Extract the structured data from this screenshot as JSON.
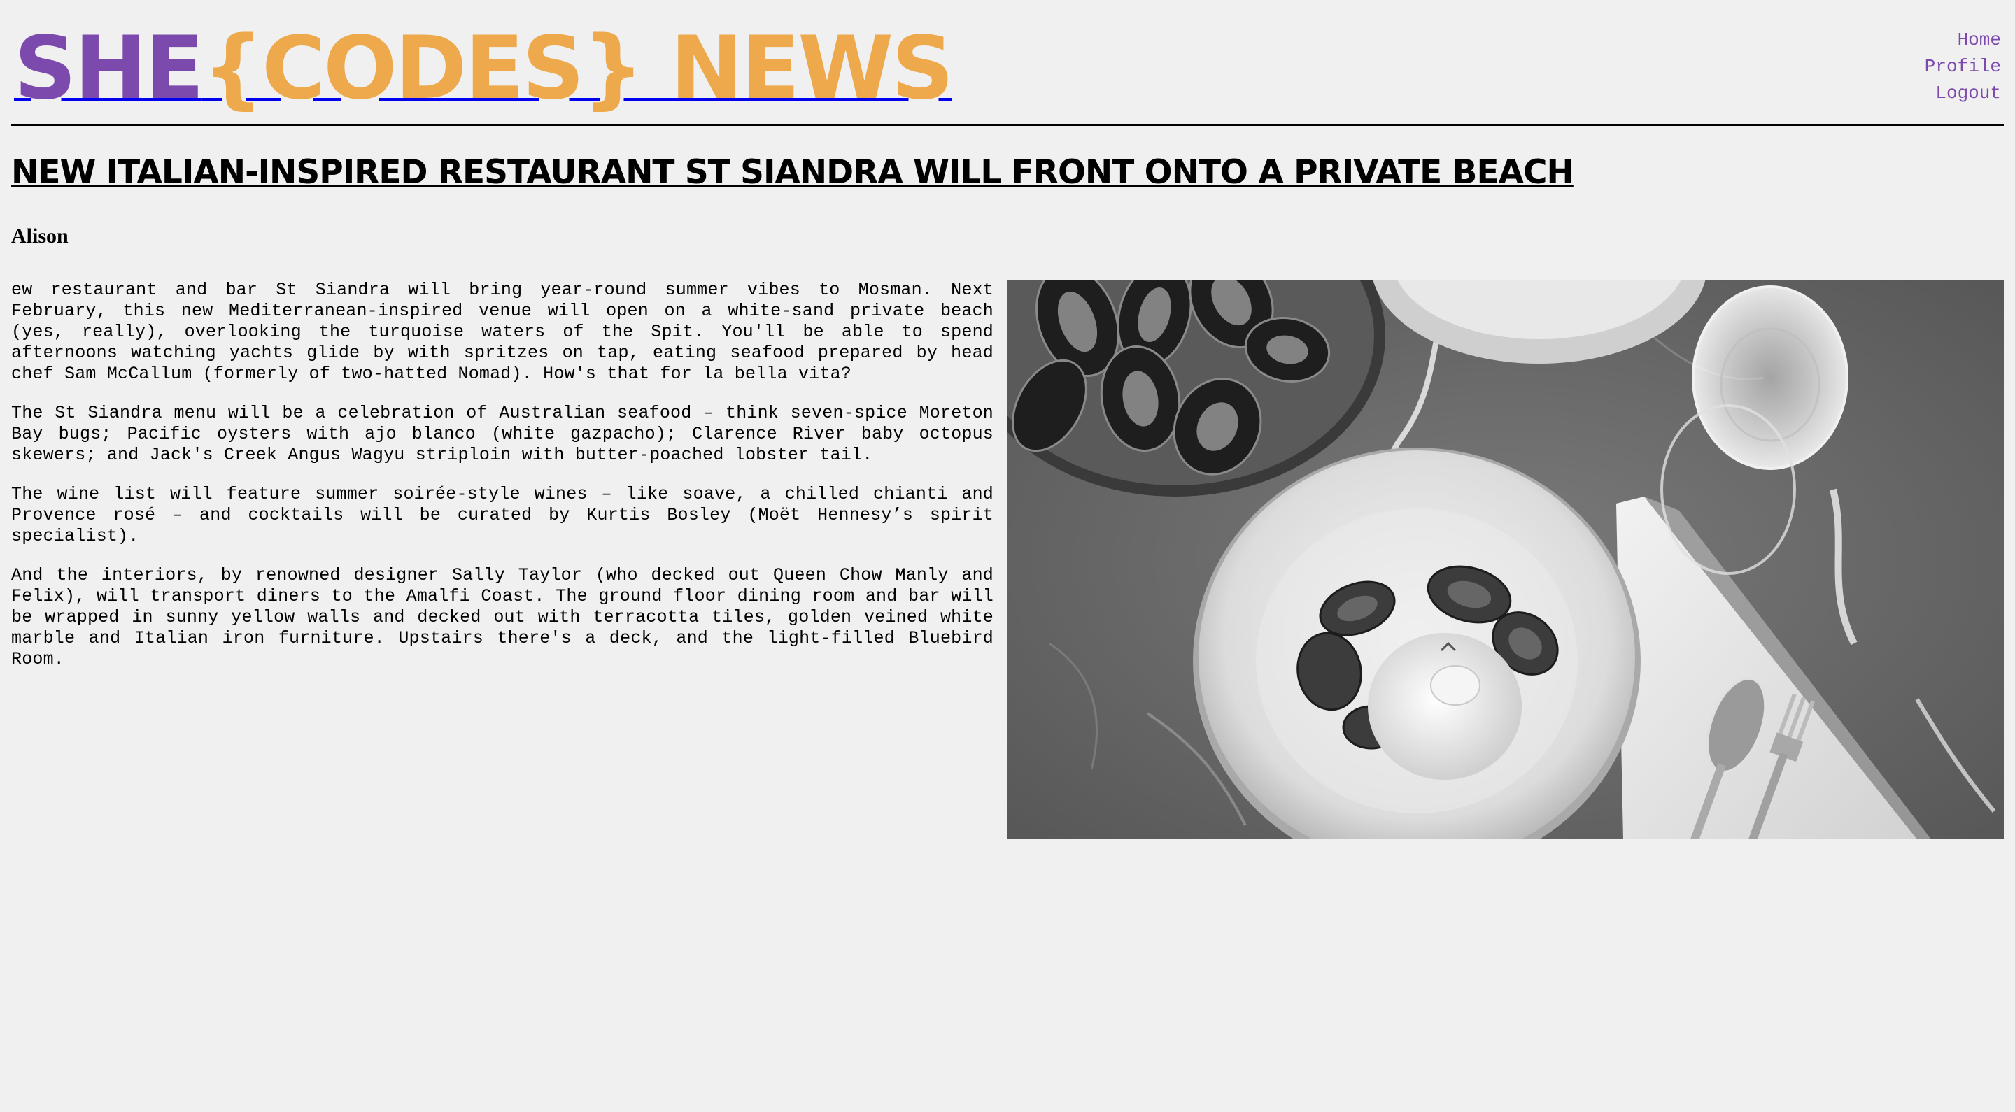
{
  "header": {
    "logo_she": "SHE",
    "logo_rest": "{CODES} NEWS",
    "nav": [
      {
        "label": "Home"
      },
      {
        "label": "Profile"
      },
      {
        "label": "Logout"
      }
    ]
  },
  "article": {
    "title": "NEW ITALIAN-INSPIRED RESTAURANT ST SIANDRA WILL FRONT ONTO A PRIVATE BEACH",
    "author": "Alison",
    "paragraphs": [
      "ew restaurant and bar St Siandra will bring year-round summer vibes to Mosman. Next February, this new Mediterranean-inspired venue will open on a white-sand private beach (yes, really), overlooking the turquoise waters of the Spit. You'll be able to spend afternoons watching yachts glide by with spritzes on tap, eating seafood prepared by head chef Sam McCallum (formerly of two-hatted Nomad). How's that for la bella vita?",
      "The St Siandra menu will be a celebration of Australian seafood – think seven-spice Moreton Bay bugs; Pacific oysters with ajo blanco (white gazpacho); Clarence River baby octopus skewers; and Jack's Creek Angus Wagyu striploin with butter-poached lobster tail.",
      "The wine list will feature summer soirée-style wines – like soave, a chilled chianti and Provence rosé – and cocktails will be curated by Kurtis Bosley (Moët Hennesy’s spirit specialist).",
      "And the interiors, by renowned designer Sally Taylor (who decked out Queen Chow Manly and Felix), will transport diners to the Amalfi Coast. The ground floor dining room and bar will be wrapped in sunny yellow walls and decked out with terracotta tiles, golden veined white marble and Italian iron furniture. Upstairs there's a deck, and the light-filled Bluebird Room."
    ]
  },
  "colors": {
    "she_purple": "#7c4aac",
    "codes_orange": "#eda94b",
    "background": "#f0f0f0"
  }
}
